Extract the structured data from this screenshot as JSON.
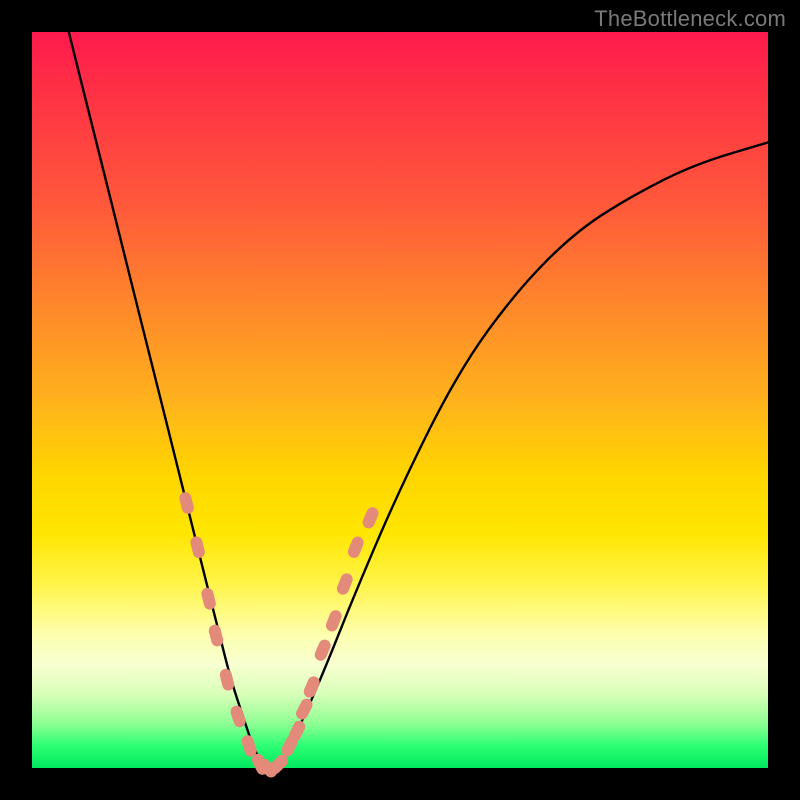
{
  "watermark": "TheBottleneck.com",
  "chart_data": {
    "type": "line",
    "title": "",
    "xlabel": "",
    "ylabel": "",
    "xlim": [
      0,
      100
    ],
    "ylim": [
      0,
      100
    ],
    "grid": false,
    "legend": false,
    "curve": {
      "description": "V-shaped bottleneck curve with steep left descent, minimum near x≈32, gentler right ascent",
      "x": [
        5,
        8,
        12,
        16,
        20,
        23,
        25,
        27,
        29,
        30,
        31,
        32,
        33,
        34,
        35,
        37,
        40,
        44,
        50,
        58,
        66,
        74,
        82,
        90,
        100
      ],
      "y": [
        100,
        88,
        72,
        56,
        40,
        28,
        20,
        12,
        6,
        3,
        1,
        0,
        0,
        1,
        3,
        7,
        14,
        24,
        38,
        54,
        65,
        73,
        78,
        82,
        85
      ]
    },
    "markers": {
      "description": "Short rounded salmon/orange tick markers overlaid along the curve near the trough",
      "points": [
        {
          "x": 21,
          "y": 36
        },
        {
          "x": 22.5,
          "y": 30
        },
        {
          "x": 24,
          "y": 23
        },
        {
          "x": 25,
          "y": 18
        },
        {
          "x": 26.5,
          "y": 12
        },
        {
          "x": 28,
          "y": 7
        },
        {
          "x": 29.5,
          "y": 3
        },
        {
          "x": 31,
          "y": 0.5
        },
        {
          "x": 32,
          "y": 0
        },
        {
          "x": 33.5,
          "y": 0.5
        },
        {
          "x": 35,
          "y": 3
        },
        {
          "x": 36,
          "y": 5
        },
        {
          "x": 37,
          "y": 8
        },
        {
          "x": 38,
          "y": 11
        },
        {
          "x": 39.5,
          "y": 16
        },
        {
          "x": 41,
          "y": 20
        },
        {
          "x": 42.5,
          "y": 25
        },
        {
          "x": 44,
          "y": 30
        },
        {
          "x": 46,
          "y": 34
        }
      ],
      "color": "#e38a7a"
    },
    "background_bands": [
      {
        "from_y": 100,
        "to_y": 70,
        "color_hint": "red"
      },
      {
        "from_y": 70,
        "to_y": 30,
        "color_hint": "orange-yellow"
      },
      {
        "from_y": 30,
        "to_y": 10,
        "color_hint": "yellow-pale"
      },
      {
        "from_y": 10,
        "to_y": 0,
        "color_hint": "green"
      }
    ]
  }
}
